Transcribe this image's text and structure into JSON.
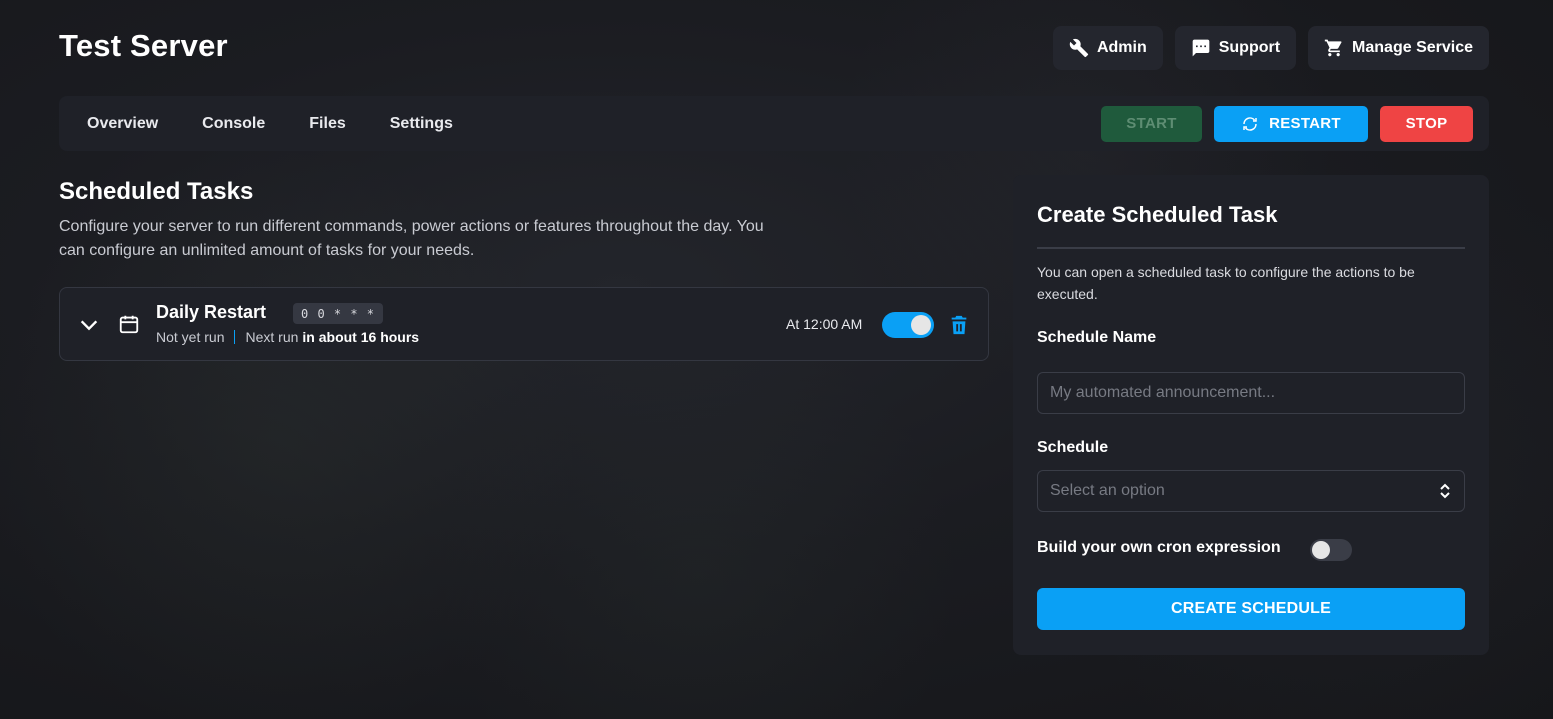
{
  "header": {
    "title": "Test Server",
    "actions": [
      {
        "label": "Admin",
        "icon": "tools-icon"
      },
      {
        "label": "Support",
        "icon": "chat-icon"
      },
      {
        "label": "Manage Service",
        "icon": "cart-icon"
      }
    ]
  },
  "nav": {
    "tabs": [
      "Overview",
      "Console",
      "Files",
      "Settings"
    ],
    "power": {
      "start": "START",
      "restart": "RESTART",
      "stop": "STOP"
    }
  },
  "schedules": {
    "title": "Scheduled Tasks",
    "description": "Configure your server to run different commands, power actions or features throughout the day. You can configure an unlimited amount of tasks for your needs.",
    "tasks": [
      {
        "name": "Daily Restart",
        "cron": "0 0 * * *",
        "last_run": "Not yet run",
        "next_run_prefix": "Next run",
        "next_run": "in about 16 hours",
        "time": "At 12:00 AM",
        "enabled": true
      }
    ]
  },
  "create": {
    "title": "Create Scheduled Task",
    "description": "You can open a scheduled task to configure the actions to be executed.",
    "name_label": "Schedule Name",
    "name_placeholder": "My automated announcement...",
    "schedule_label": "Schedule",
    "schedule_placeholder": "Select an option",
    "cron_toggle_label": "Build your own cron expression",
    "cron_toggle_enabled": false,
    "submit_label": "CREATE SCHEDULE"
  },
  "colors": {
    "accent": "#0aa0f5",
    "danger": "#ef4444",
    "start_disabled": "#1f5a3c",
    "panel": "#1f2128"
  }
}
